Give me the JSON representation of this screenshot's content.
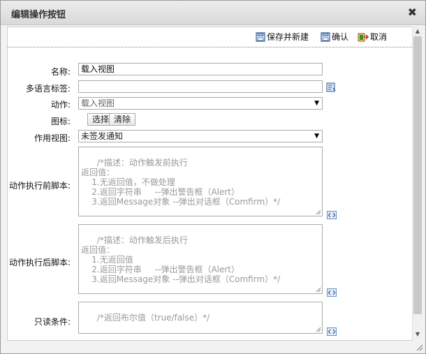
{
  "dialog": {
    "title": "编辑操作按钮"
  },
  "toolbar": {
    "save_new": "保存并新建",
    "confirm": "确认",
    "cancel": "取消"
  },
  "form": {
    "name": {
      "label": "名称:",
      "value": "载入视图"
    },
    "i18n": {
      "label": "多语言标签:",
      "value": ""
    },
    "action": {
      "label": "动作:",
      "value": "载入视图"
    },
    "icon": {
      "label": "图标:",
      "select_btn": "选择",
      "clear_btn": "清除"
    },
    "view": {
      "label": "作用视图:",
      "value": "未签发通知"
    },
    "before_script": {
      "label": "动作执行前脚本:",
      "value": "/*描述：动作触发前执行\n返回值：\n    1.无返回值，不做处理\n    2.返回字符串     --弹出警告框（Alert）\n    3.返回Message对象 --弹出对话框（Comfirm）*/"
    },
    "after_script": {
      "label": "动作执行后脚本:",
      "value": "/*描述：动作触发后执行\n返回值：\n    1.无返回值\n    2.返回字符串     --弹出警告框（Alert）\n    3.返回Message对象 --弹出对话框（Comfirm）*/"
    },
    "readonly": {
      "label": "只读条件:",
      "value": "/*返回布尔值（true/false）*/"
    }
  },
  "icons": {
    "close": "close-icon",
    "save_new": "save-icon",
    "confirm": "confirm-icon",
    "cancel": "cancel-icon",
    "i18n": "translate-icon",
    "code": "code-editor-icon"
  }
}
